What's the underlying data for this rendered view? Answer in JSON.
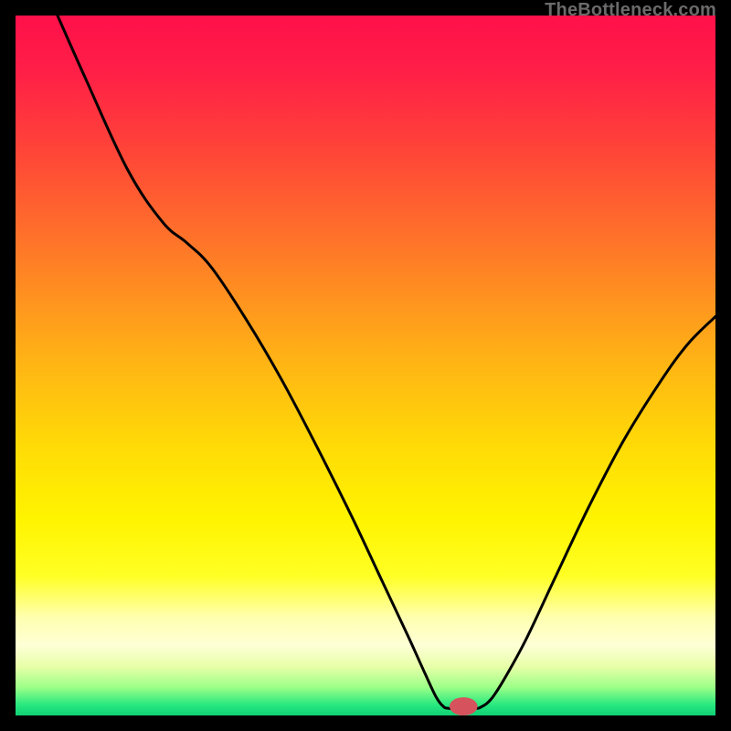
{
  "watermark": "TheBottleneck.com",
  "chart_data": {
    "type": "line",
    "title": "",
    "xlabel": "",
    "ylabel": "",
    "xlim": [
      0,
      100
    ],
    "ylim": [
      0,
      100
    ],
    "gradient_stops": [
      {
        "offset": 0.0,
        "color": "#ff104a"
      },
      {
        "offset": 0.08,
        "color": "#ff1f47"
      },
      {
        "offset": 0.2,
        "color": "#ff4737"
      },
      {
        "offset": 0.35,
        "color": "#ff7e26"
      },
      {
        "offset": 0.5,
        "color": "#ffb614"
      },
      {
        "offset": 0.62,
        "color": "#ffdc06"
      },
      {
        "offset": 0.72,
        "color": "#fff400"
      },
      {
        "offset": 0.8,
        "color": "#ffff24"
      },
      {
        "offset": 0.86,
        "color": "#ffffb0"
      },
      {
        "offset": 0.9,
        "color": "#fdffd6"
      },
      {
        "offset": 0.93,
        "color": "#e8ffa8"
      },
      {
        "offset": 0.96,
        "color": "#9cff88"
      },
      {
        "offset": 0.985,
        "color": "#26e87f"
      },
      {
        "offset": 1.0,
        "color": "#11d077"
      }
    ],
    "curve": [
      {
        "x": 6.0,
        "y": 100.0
      },
      {
        "x": 10.0,
        "y": 91.0
      },
      {
        "x": 16.0,
        "y": 78.0
      },
      {
        "x": 21.0,
        "y": 70.5
      },
      {
        "x": 24.5,
        "y": 67.5
      },
      {
        "x": 28.0,
        "y": 64.0
      },
      {
        "x": 33.0,
        "y": 56.5
      },
      {
        "x": 38.0,
        "y": 48.0
      },
      {
        "x": 43.0,
        "y": 38.5
      },
      {
        "x": 48.0,
        "y": 28.5
      },
      {
        "x": 52.0,
        "y": 20.0
      },
      {
        "x": 56.0,
        "y": 11.5
      },
      {
        "x": 58.5,
        "y": 6.0
      },
      {
        "x": 60.0,
        "y": 2.8
      },
      {
        "x": 61.0,
        "y": 1.4
      },
      {
        "x": 62.0,
        "y": 1.0
      },
      {
        "x": 65.5,
        "y": 1.0
      },
      {
        "x": 66.5,
        "y": 1.2
      },
      {
        "x": 68.0,
        "y": 2.4
      },
      {
        "x": 70.0,
        "y": 5.5
      },
      {
        "x": 73.0,
        "y": 11.0
      },
      {
        "x": 77.0,
        "y": 19.5
      },
      {
        "x": 82.0,
        "y": 30.0
      },
      {
        "x": 87.0,
        "y": 39.5
      },
      {
        "x": 92.0,
        "y": 47.5
      },
      {
        "x": 96.0,
        "y": 53.0
      },
      {
        "x": 100.0,
        "y": 57.0
      }
    ],
    "marker": {
      "x": 64.0,
      "y": 0.0,
      "rx": 2.0,
      "ry": 1.3,
      "color": "#d6525d"
    }
  }
}
